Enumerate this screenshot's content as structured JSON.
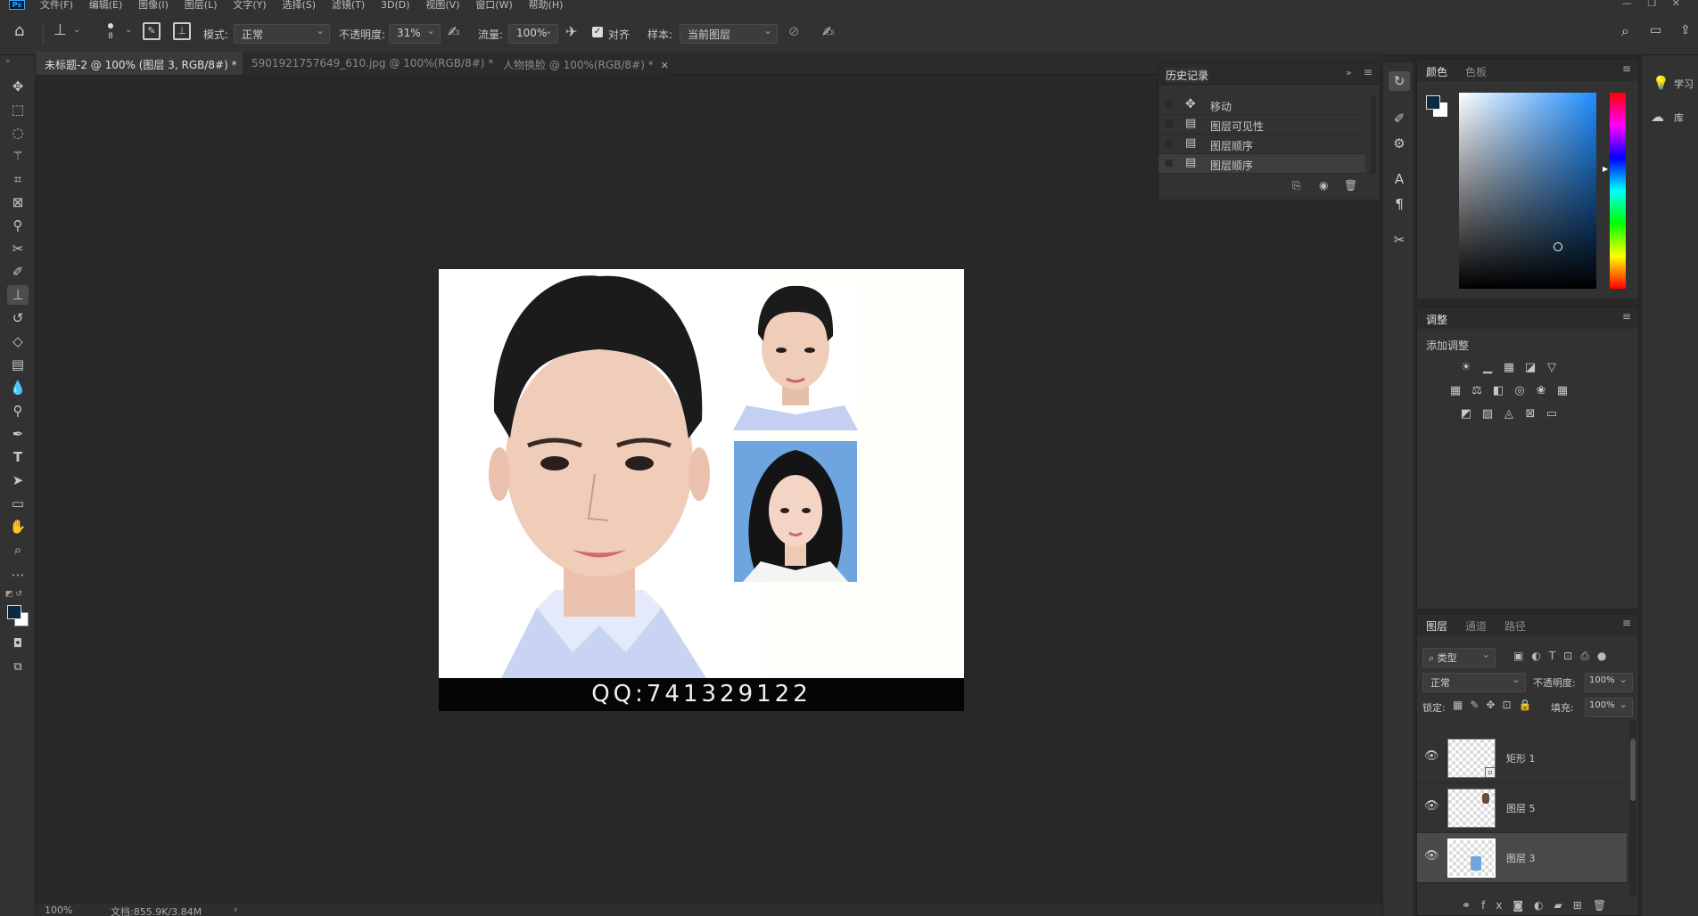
{
  "menu": {
    "logo": "Ps",
    "items": [
      "文件(F)",
      "编辑(E)",
      "图像(I)",
      "图层(L)",
      "文字(Y)",
      "选择(S)",
      "滤镜(T)",
      "3D(D)",
      "视图(V)",
      "窗口(W)",
      "帮助(H)"
    ]
  },
  "options": {
    "brush_size": "8",
    "mode_label": "模式:",
    "mode_value": "正常",
    "opacity_label": "不透明度:",
    "opacity_value": "31%",
    "flow_label": "流量:",
    "flow_value": "100%",
    "align_label": "对齐",
    "sample_label": "样本:",
    "sample_value": "当前图层"
  },
  "tabs": [
    {
      "label": "未标题-2 @ 100% (图层 3, RGB/8#) *",
      "active": true
    },
    {
      "label": "5901921757649_610.jpg @ 100%(RGB/8#) *",
      "active": false
    },
    {
      "label": "人物换脸 @ 100%(RGB/8#) *",
      "active": false
    }
  ],
  "canvas": {
    "caption": "QQ:741329122"
  },
  "status": {
    "zoom": "100%",
    "doc_size": "文档:855.9K/3.84M",
    "arrow": "›"
  },
  "history": {
    "title": "历史记录",
    "items": [
      {
        "label": "移动",
        "icon": "move-icon"
      },
      {
        "label": "图层可见性",
        "icon": "document-icon"
      },
      {
        "label": "图层顺序",
        "icon": "document-icon"
      },
      {
        "label": "图层顺序",
        "icon": "document-icon"
      }
    ]
  },
  "color_panel": {
    "tab1": "颜色",
    "tab2": "色板"
  },
  "adjust_panel": {
    "title": "调整",
    "add_label": "添加调整"
  },
  "layers_panel": {
    "tab1": "图层",
    "tab2": "通道",
    "tab3": "路径",
    "filter": "类型",
    "blend": "正常",
    "opacity_label": "不透明度:",
    "opacity_value": "100%",
    "lock_label": "锁定:",
    "fill_label": "填充:",
    "fill_value": "100%",
    "layers": [
      {
        "name": "矩形 1",
        "selected": false
      },
      {
        "name": "图层 5",
        "selected": false
      },
      {
        "name": "图层 3",
        "selected": true
      }
    ]
  },
  "far_right": {
    "learn": "学习",
    "library": "库"
  },
  "colors": {
    "accent": "#31a8ff",
    "foreground": "#0b2a44",
    "background_swatch": "#ffffff"
  }
}
